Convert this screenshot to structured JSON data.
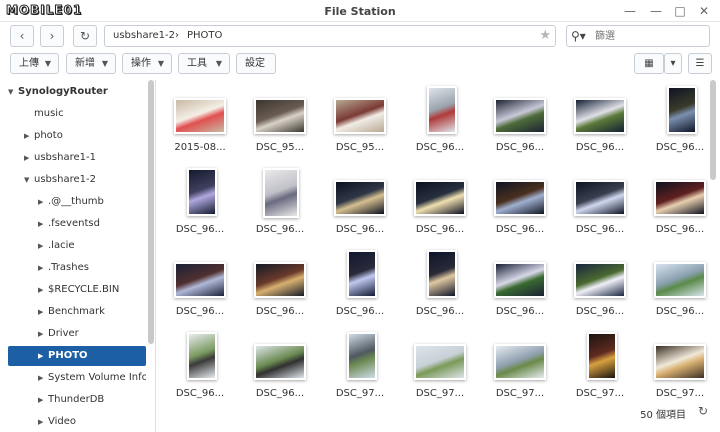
{
  "window": {
    "logo_text": "MOBILE01",
    "title": "File Station",
    "minimize_glyph": "?",
    "close_glyph": "✕",
    "pin_glyph": "—",
    "maximize_glyph": "□"
  },
  "nav": {
    "back_icon": "chevron-left-icon",
    "forward_icon": "chevron-right-icon",
    "refresh_icon": "refresh-icon",
    "breadcrumb": [
      "usbshare1-2",
      "PHOTO"
    ],
    "breadcrumb_sep": "›",
    "search_placeholder": "篩選"
  },
  "toolbar": {
    "upload_label": "上傳",
    "create_label": "新增",
    "action_label": "操作",
    "tools_label": "工具",
    "settings_label": "設定"
  },
  "sidebar": {
    "root": "SynologyRouter",
    "items": [
      {
        "label": "music",
        "level": 1,
        "arrow": ""
      },
      {
        "label": "photo",
        "level": 1,
        "arrow": "▶"
      },
      {
        "label": "usbshare1-1",
        "level": 1,
        "arrow": "▶"
      },
      {
        "label": "usbshare1-2",
        "level": 1,
        "arrow": "▼"
      },
      {
        "label": ".@__thumb",
        "level": 2,
        "arrow": "▶"
      },
      {
        "label": ".fseventsd",
        "level": 2,
        "arrow": "▶"
      },
      {
        "label": ".lacie",
        "level": 2,
        "arrow": "▶"
      },
      {
        "label": ".Trashes",
        "level": 2,
        "arrow": "▶"
      },
      {
        "label": "$RECYCLE.BIN",
        "level": 2,
        "arrow": "▶"
      },
      {
        "label": "Benchmark",
        "level": 2,
        "arrow": "▶"
      },
      {
        "label": "Driver",
        "level": 2,
        "arrow": "▶"
      },
      {
        "label": "PHOTO",
        "level": 2,
        "arrow": "▶",
        "selected": true
      },
      {
        "label": "System Volume Info",
        "level": 2,
        "arrow": "▶"
      },
      {
        "label": "ThunderDB",
        "level": 2,
        "arrow": "▶"
      },
      {
        "label": "Video",
        "level": 2,
        "arrow": "▶"
      }
    ]
  },
  "files": [
    {
      "name": "2015-08...",
      "orient": "land",
      "colors": [
        "#c9b9a4",
        "#e05050",
        "#f4efe6"
      ]
    },
    {
      "name": "DSC_95...",
      "orient": "land",
      "colors": [
        "#3b3631",
        "#d9d2c8",
        "#6a5c52"
      ]
    },
    {
      "name": "DSC_95...",
      "orient": "land",
      "colors": [
        "#b8a894",
        "#f1ece5",
        "#7b3a34"
      ]
    },
    {
      "name": "DSC_96...",
      "orient": "port",
      "colors": [
        "#dfe4ea",
        "#b03a3a",
        "#9aa4ad"
      ]
    },
    {
      "name": "DSC_96...",
      "orient": "land",
      "colors": [
        "#1d2332",
        "#4d6b3a",
        "#c8c8d8"
      ]
    },
    {
      "name": "DSC_96...",
      "orient": "land",
      "colors": [
        "#142033",
        "#5c7a3a",
        "#e0e0e8"
      ]
    },
    {
      "name": "DSC_96...",
      "orient": "port",
      "colors": [
        "#0f1524",
        "#7a8fb0",
        "#3a3a2a"
      ]
    },
    {
      "name": "DSC_96...",
      "orient": "port",
      "colors": [
        "#121a2c",
        "#b0a8e0",
        "#404060"
      ]
    },
    {
      "name": "DSC_96...",
      "orient": "portw",
      "colors": [
        "#eaeaea",
        "#6a6a80",
        "#c0c0c8"
      ]
    },
    {
      "name": "DSC_96...",
      "orient": "land",
      "colors": [
        "#0b1020",
        "#d6c090",
        "#303848"
      ]
    },
    {
      "name": "DSC_96...",
      "orient": "land",
      "colors": [
        "#0b1020",
        "#f0e0b0",
        "#283040"
      ]
    },
    {
      "name": "DSC_96...",
      "orient": "land",
      "colors": [
        "#101422",
        "#a0b0d0",
        "#4a3020"
      ]
    },
    {
      "name": "DSC_96...",
      "orient": "land",
      "colors": [
        "#0d1322",
        "#d0d8f0",
        "#3a4050"
      ]
    },
    {
      "name": "DSC_96...",
      "orient": "land",
      "colors": [
        "#0e1220",
        "#e8d0b0",
        "#602020"
      ]
    },
    {
      "name": "DSC_96...",
      "orient": "land",
      "colors": [
        "#1a2036",
        "#b0b8d8",
        "#503030"
      ]
    },
    {
      "name": "DSC_96...",
      "orient": "land",
      "colors": [
        "#151a28",
        "#d8b070",
        "#6a3a2a"
      ]
    },
    {
      "name": "DSC_96...",
      "orient": "port",
      "colors": [
        "#101830",
        "#c0c8f0",
        "#2a2a3a"
      ]
    },
    {
      "name": "DSC_96...",
      "orient": "port",
      "colors": [
        "#0d1428",
        "#e0c8a0",
        "#2a2a38"
      ]
    },
    {
      "name": "DSC_96...",
      "orient": "land",
      "colors": [
        "#182036",
        "#3a6a30",
        "#d8d8e8"
      ]
    },
    {
      "name": "DSC_96...",
      "orient": "land",
      "colors": [
        "#1a2540",
        "#f0f0f8",
        "#4a6a30"
      ]
    },
    {
      "name": "DSC_96...",
      "orient": "land",
      "colors": [
        "#d8e4ee",
        "#5b8a4a",
        "#8aa0b0"
      ]
    },
    {
      "name": "DSC_96...",
      "orient": "port",
      "colors": [
        "#e8ecef",
        "#3a3a3a",
        "#7a9a60"
      ]
    },
    {
      "name": "DSC_96...",
      "orient": "land",
      "colors": [
        "#dfe6ec",
        "#303030",
        "#6a8a50"
      ]
    },
    {
      "name": "DSC_97...",
      "orient": "port",
      "colors": [
        "#d0dce8",
        "#6a8a50",
        "#505860"
      ]
    },
    {
      "name": "DSC_97...",
      "orient": "land",
      "colors": [
        "#dde4ea",
        "#7a9a58",
        "#c8d0d8"
      ]
    },
    {
      "name": "DSC_97...",
      "orient": "land",
      "colors": [
        "#e6ecf0",
        "#6a8a4a",
        "#90a0b0"
      ]
    },
    {
      "name": "DSC_97...",
      "orient": "port",
      "colors": [
        "#1a1410",
        "#d8a040",
        "#602a20"
      ]
    },
    {
      "name": "DSC_97...",
      "orient": "land",
      "colors": [
        "#3a2e24",
        "#d8b070",
        "#f0e8d8"
      ]
    }
  ],
  "status": {
    "count": "50 個項目",
    "refresh_icon": "refresh-icon"
  }
}
